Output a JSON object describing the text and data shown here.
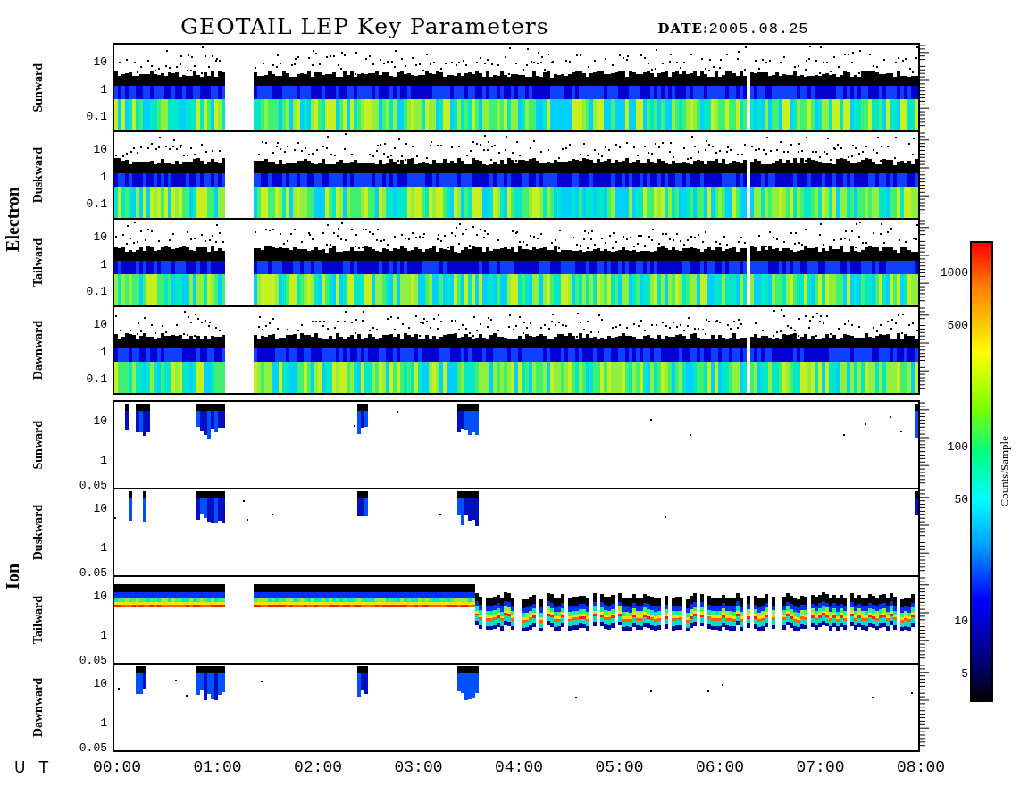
{
  "title": "GEOTAIL LEP Key Parameters",
  "date": "**DATE:**2005.08.25",
  "groups": [
    {
      "name": "Electron",
      "panels": [
        {
          "label": "Sunward",
          "kind": "dense",
          "yticks": [
            "10",
            "1",
            "0.1"
          ]
        },
        {
          "label": "Duskward",
          "kind": "dense",
          "yticks": [
            "10",
            "1",
            "0.1"
          ]
        },
        {
          "label": "Tailward",
          "kind": "dense",
          "yticks": [
            "10",
            "1",
            "0.1"
          ]
        },
        {
          "label": "Dawnward",
          "kind": "dense",
          "yticks": [
            "10",
            "1",
            "0.1"
          ]
        }
      ]
    },
    {
      "name": "Ion",
      "panels": [
        {
          "label": "Sunward",
          "kind": "sparse",
          "yticks": [
            "10",
            "1",
            "0.05"
          ]
        },
        {
          "label": "Duskward",
          "kind": "sparse",
          "yticks": [
            "10",
            "1",
            "0.05"
          ]
        },
        {
          "label": "Tailward",
          "kind": "banded",
          "yticks": [
            "10",
            "1",
            "0.05"
          ]
        },
        {
          "label": "Dawnward",
          "kind": "sparse",
          "yticks": [
            "10",
            "1",
            "0.05"
          ]
        }
      ]
    }
  ],
  "x_axis": {
    "label": "U T",
    "ticks": [
      "00:00",
      "01:00",
      "02:00",
      "03:00",
      "04:00",
      "05:00",
      "06:00",
      "07:00",
      "08:00"
    ]
  },
  "colorbar": {
    "title": "Counts/Sample",
    "ticks": [
      "1000",
      "500",
      "100",
      "50",
      "10",
      "5"
    ]
  }
}
